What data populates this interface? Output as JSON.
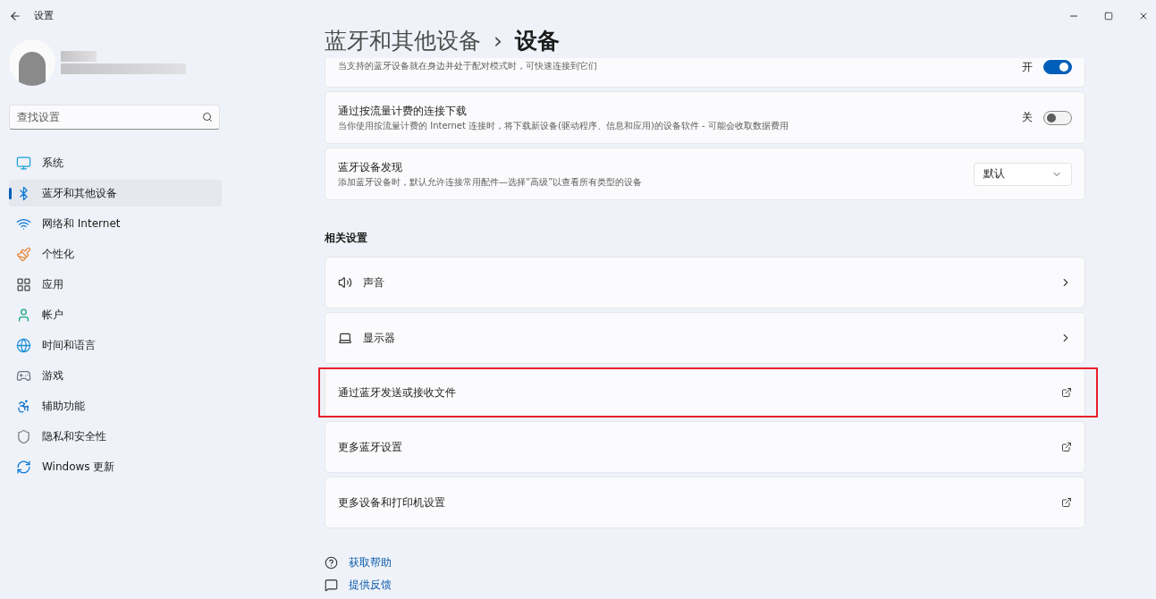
{
  "window": {
    "title": "设置"
  },
  "search": {
    "placeholder": "查找设置"
  },
  "sidebar": {
    "items": [
      {
        "label": "系统",
        "selected": false
      },
      {
        "label": "蓝牙和其他设备",
        "selected": true
      },
      {
        "label": "网络和 Internet",
        "selected": false
      },
      {
        "label": "个性化",
        "selected": false
      },
      {
        "label": "应用",
        "selected": false
      },
      {
        "label": "帐户",
        "selected": false
      },
      {
        "label": "时间和语言",
        "selected": false
      },
      {
        "label": "游戏",
        "selected": false
      },
      {
        "label": "辅助功能",
        "selected": false
      },
      {
        "label": "隐私和安全性",
        "selected": false
      },
      {
        "label": "Windows 更新",
        "selected": false
      }
    ]
  },
  "breadcrumb": {
    "parent": "蓝牙和其他设备",
    "separator": "›",
    "current": "设备"
  },
  "settings": [
    {
      "kind": "toggle",
      "description": "当支持的蓝牙设备就在身边并处于配对模式时，可快速连接到它们",
      "state_label": "开",
      "on": true
    },
    {
      "kind": "toggle",
      "title": "通过按流量计费的连接下载",
      "description": "当你使用按流量计费的 Internet 连接时，将下载新设备(驱动程序、信息和应用)的设备软件 - 可能会收取数据费用",
      "state_label": "关",
      "on": false
    },
    {
      "kind": "dropdown",
      "title": "蓝牙设备发现",
      "description": "添加蓝牙设备时，默认允许连接常用配件—选择“高级”以查看所有类型的设备",
      "value": "默认"
    }
  ],
  "related": {
    "heading": "相关设置",
    "items": [
      {
        "label": "声音",
        "kind": "chevron",
        "highlighted": false
      },
      {
        "label": "显示器",
        "kind": "chevron",
        "highlighted": false
      },
      {
        "label": "通过蓝牙发送或接收文件",
        "kind": "external",
        "highlighted": true
      },
      {
        "label": "更多蓝牙设置",
        "kind": "external",
        "highlighted": false
      },
      {
        "label": "更多设备和打印机设置",
        "kind": "external",
        "highlighted": false
      }
    ]
  },
  "help_links": [
    {
      "label": "获取帮助"
    },
    {
      "label": "提供反馈"
    }
  ]
}
